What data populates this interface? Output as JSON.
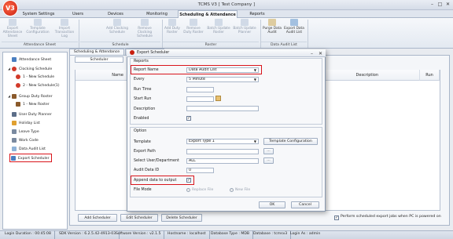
{
  "app": {
    "title": "TCMS V3 [ Test Company ]",
    "logo_text": "V3"
  },
  "ribbon_tabs": [
    "System Settings",
    "Users",
    "Devices",
    "Monitoring",
    "Scheduling & Attendance",
    "Reports"
  ],
  "ribbon": {
    "groups": [
      {
        "label": "Attendance Sheet",
        "buttons": [
          "Export Attendance Sheet",
          "Template Configuration",
          "Import Transaction Log"
        ]
      },
      {
        "label": "Schedule",
        "buttons": [
          "Add Clocking Schedule",
          "Remove Clocking Schedule"
        ]
      },
      {
        "label": "Roster",
        "buttons": [
          "Add Duty Roster",
          "Remove Duty Roster",
          "Batch Update Roster",
          "Batch Update Planner"
        ]
      },
      {
        "label": "Data Audit List",
        "buttons": [
          "Purge Data Audit",
          "Export Data Audit List"
        ]
      }
    ]
  },
  "tree": [
    {
      "label": "Attendance Sheet",
      "level": 0,
      "toggle": ""
    },
    {
      "label": "Clocking Schedule",
      "level": 0,
      "toggle": "◢"
    },
    {
      "label": "1 - New Schedule",
      "level": 1,
      "toggle": ""
    },
    {
      "label": "2 - New Schedule(1)",
      "level": 1,
      "toggle": ""
    },
    {
      "label": "Group Duty Roster",
      "level": 0,
      "toggle": "◢"
    },
    {
      "label": "1 - New Roster",
      "level": 1,
      "toggle": ""
    },
    {
      "label": "User Duty Planner",
      "level": 0,
      "toggle": ""
    },
    {
      "label": "Holiday List",
      "level": 0,
      "toggle": ""
    },
    {
      "label": "Leave Type",
      "level": 0,
      "toggle": ""
    },
    {
      "label": "Work Code",
      "level": 0,
      "toggle": ""
    },
    {
      "label": "Data Audit List",
      "level": 0,
      "toggle": ""
    },
    {
      "label": "Export Scheduler",
      "level": 0,
      "toggle": ""
    }
  ],
  "main_tabs": [
    "Scheduling & Attendance",
    "Export Scheduler"
  ],
  "sub_tab": "Scheduler",
  "grid_headers": [
    "Name",
    "Description",
    "Run"
  ],
  "bottom_buttons": {
    "add": "Add Scheduler",
    "edit": "Edit Scheduler",
    "delete": "Delete Scheduler"
  },
  "perform_checkbox": {
    "label": "Perform scheduled export jobs when PC is powered on",
    "checked": "✓"
  },
  "status": {
    "login_duration": "Login Duration : 00:45:08",
    "sdk": "SDK Version : 6.2.5.42-4913-03",
    "software": "Software Version : v2.1.5",
    "hostname": "Hostname : localhost",
    "dbtype": "Database Type : MDB",
    "database": "Database : tcmsv3",
    "login_as": "Login As : admin"
  },
  "dialog": {
    "title": "Export Scheduler",
    "reports_section": "Reports",
    "report_name_label": "Report Name",
    "report_name_value": "Data Audit List",
    "every_label": "Every",
    "every_value": "5 Minute",
    "runtime_label": "Run Time",
    "startrun_label": "Start Run",
    "description_label": "Description",
    "enabled_label": "Enabled",
    "enabled_checked": "✓",
    "option_section": "Option",
    "template_label": "Template",
    "template_value": "Export Type 1",
    "template_config_btn": "Template Configuration",
    "export_path_label": "Export Path",
    "browse_btn": "...",
    "select_user_label": "Select User/Department",
    "select_user_value": "ALL",
    "audit_id_label": "Audit Data ID",
    "audit_id_value": "0",
    "append_label": "Append data to output",
    "append_checked": "✓",
    "filemode_label": "File Mode",
    "replace_file": "Replace File",
    "new_file": "New File",
    "ok": "OK",
    "cancel": "Cancel"
  },
  "colors": {
    "highlight": "#d9141b",
    "accent": "#c81e0e"
  }
}
